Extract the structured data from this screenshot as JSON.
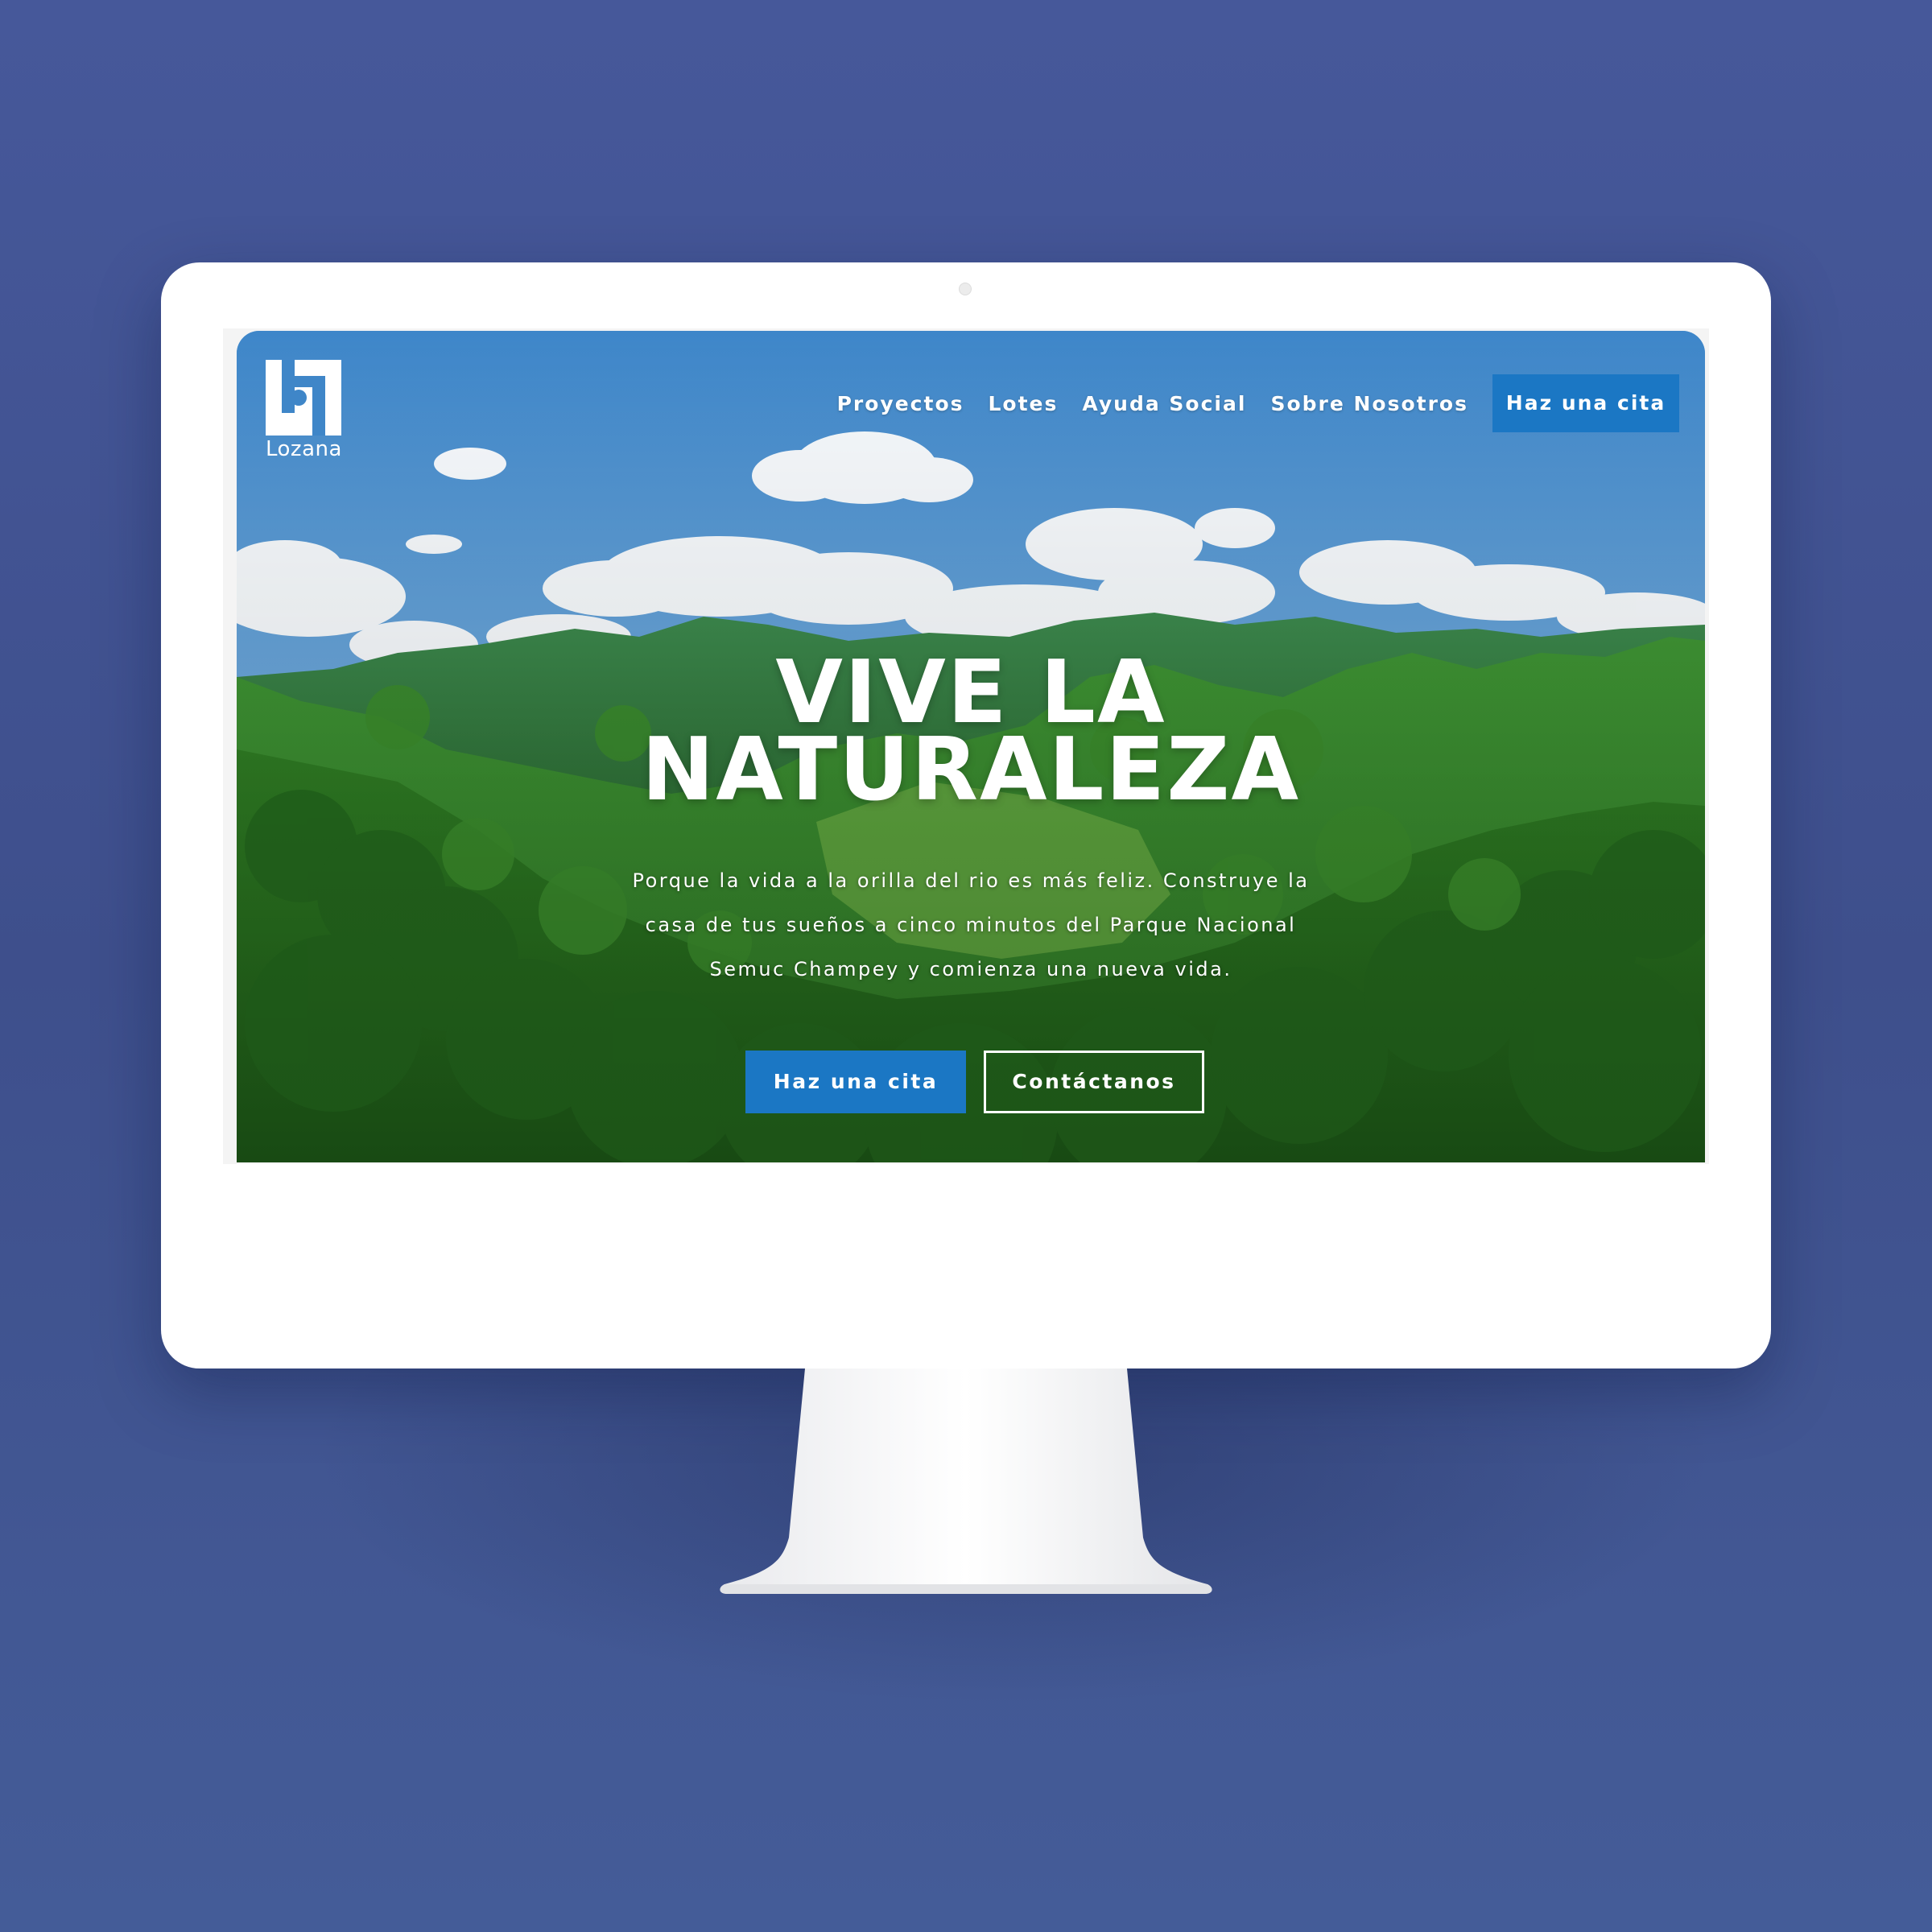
{
  "brand": {
    "name": "Lozana"
  },
  "nav": {
    "items": [
      "Proyectos",
      "Lotes",
      "Ayuda Social",
      "Sobre Nosotros"
    ],
    "cta_label": "Haz una cita"
  },
  "hero": {
    "title_line1": "VIVE LA",
    "title_line2": "NATURALEZA",
    "text_line1": "Porque la vida a la orilla del rio es más feliz. Construye la",
    "text_line2": "casa de tus sueños a cinco minutos del Parque Nacional",
    "text_line3": "Semuc Champey y comienza una nueva vida.",
    "primary_button": "Haz una cita",
    "secondary_button": "Contáctanos"
  },
  "colors": {
    "background": "#425596",
    "accent_blue": "#1b77c4",
    "sky": "#5b9ad6",
    "forest": "#2f7a2a",
    "monitor": "#ffffff"
  },
  "icons": {
    "logo": "lozana-logo-icon",
    "camera": "camera-icon"
  }
}
